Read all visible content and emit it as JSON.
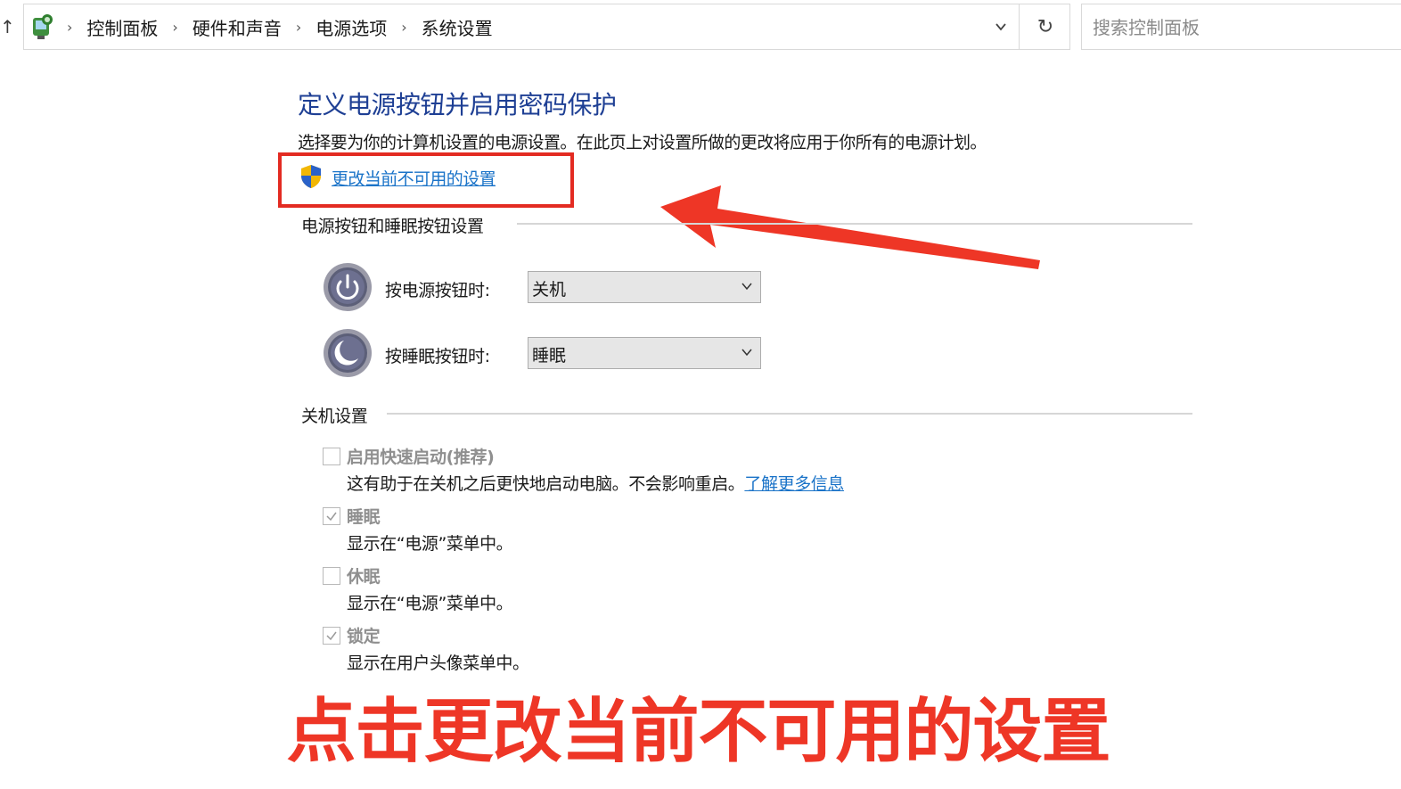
{
  "address_bar": {
    "breadcrumbs": [
      "控制面板",
      "硬件和声音",
      "电源选项",
      "系统设置"
    ],
    "refresh_glyph": "↻",
    "up_glyph": "↑"
  },
  "search": {
    "placeholder": "搜索控制面板"
  },
  "page": {
    "title": "定义电源按钮并启用密码保护",
    "description": "选择要为你的计算机设置的电源设置。在此页上对设置所做的更改将应用于你所有的电源计划。",
    "change_settings_link": "更改当前不可用的设置"
  },
  "buttons_section": {
    "title": "电源按钮和睡眠按钮设置",
    "rows": [
      {
        "label": "按电源按钮时:",
        "value": "关机",
        "icon": "power-icon"
      },
      {
        "label": "按睡眠按钮时:",
        "value": "睡眠",
        "icon": "sleep-icon"
      }
    ]
  },
  "shutdown_section": {
    "title": "关机设置",
    "items": [
      {
        "label": "启用快速启动(推荐)",
        "desc": "这有助于在关机之后更快地启动电脑。不会影响重启。",
        "link": "了解更多信息",
        "checked": false
      },
      {
        "label": "睡眠",
        "desc": "显示在“电源”菜单中。",
        "checked": true
      },
      {
        "label": "休眠",
        "desc": "显示在“电源”菜单中。",
        "checked": false
      },
      {
        "label": "锁定",
        "desc": "显示在用户头像菜单中。",
        "checked": true
      }
    ]
  },
  "annotation": {
    "caption": "点击更改当前不可用的设置",
    "highlight_color": "#e32b22",
    "arrow_color": "#ee3626"
  },
  "colors": {
    "title_blue": "#1e3f94",
    "link_blue": "#1a73c8",
    "disabled_gray": "#8f8f8f"
  }
}
